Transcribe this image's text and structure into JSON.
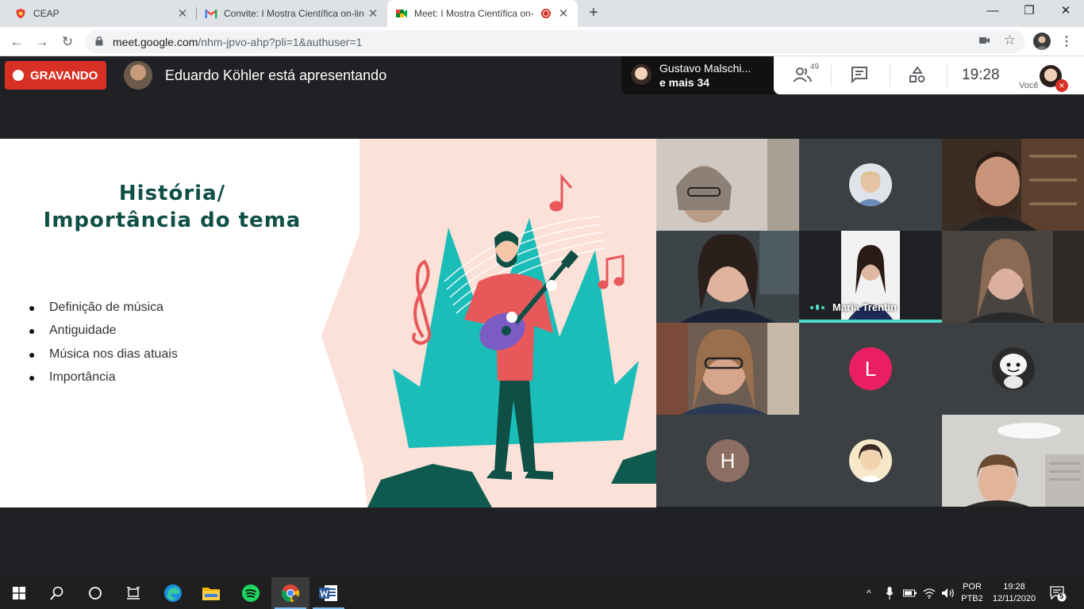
{
  "browser": {
    "tabs": [
      {
        "title": "CEAP",
        "favicon": "ceap-shield-icon",
        "close": "✕"
      },
      {
        "title": "Convite: I Mostra Científica on-lin",
        "favicon": "gmail-icon",
        "close": "✕"
      },
      {
        "title": "Meet: I Mostra Científica on-",
        "favicon": "google-meet-icon",
        "close": "✕",
        "recording_indicator": "record-dot-icon"
      }
    ],
    "new_tab": "+",
    "window_controls": {
      "minimize": "—",
      "restore": "❐",
      "close": "✕"
    },
    "url_main": "meet.google.com",
    "url_rest": "/nhm-jpvo-ahp?pli=1&authuser=1"
  },
  "meet": {
    "recording_label": "GRAVANDO",
    "presenter_text": "Eduardo Köhler está apresentando",
    "people_pill": {
      "line1": "Gustavo Malschi...",
      "line2": "e mais 34"
    },
    "participant_count": "49",
    "clock": "19:28",
    "you_label": "Você"
  },
  "slide": {
    "title_line1": "História/",
    "title_line2": "Importância do tema",
    "bullets": [
      "Definição de música",
      "Antiguidade",
      "Música nos dias atuais",
      "Importância"
    ],
    "bullet_char": "●"
  },
  "grid": {
    "active_speaker_name": "Maria Trentin",
    "letters": {
      "l": "L",
      "h": "H"
    }
  },
  "taskbar": {
    "lang_top": "POR",
    "lang_bottom": "PTB2",
    "time": "19:28",
    "date": "12/11/2020",
    "notifications": "5"
  },
  "colors": {
    "record_red": "#d93025",
    "speaker_accent": "#4cd8c8",
    "slide_title": "#0f4f46",
    "slide_bg_shape": "#fbe1d8",
    "teal": "#1bbdb8",
    "avatar_l": "#e91e63",
    "avatar_h": "#8d6e63"
  }
}
